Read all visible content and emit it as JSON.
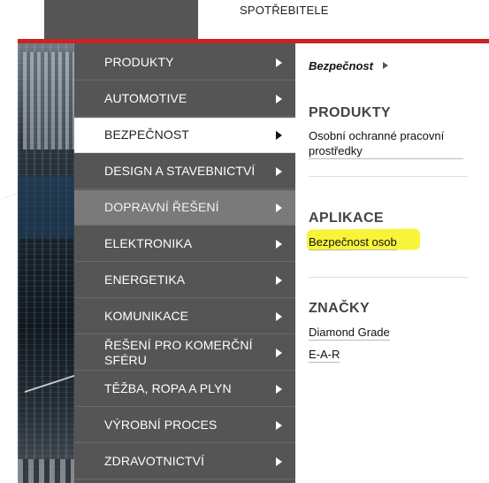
{
  "header": {
    "top_link": "SPOTŘEBITELE",
    "accent_color": "#cc2222"
  },
  "menu": {
    "items": [
      {
        "label": "PRODUKTY",
        "state": "normal"
      },
      {
        "label": "AUTOMOTIVE",
        "state": "normal"
      },
      {
        "label": "BEZPEČNOST",
        "state": "active"
      },
      {
        "label": "DESIGN A STAVEBNICTVÍ",
        "state": "normal"
      },
      {
        "label": "DOPRAVNÍ ŘEŠENÍ",
        "state": "hover"
      },
      {
        "label": "ELEKTRONIKA",
        "state": "normal"
      },
      {
        "label": "ENERGETIKA",
        "state": "normal"
      },
      {
        "label": "KOMUNIKACE",
        "state": "normal"
      },
      {
        "label": "ŘEŠENÍ PRO KOMERČNÍ SFÉRU",
        "state": "normal"
      },
      {
        "label": "TĚŽBA, ROPA A PLYN",
        "state": "normal"
      },
      {
        "label": "VÝROBNÍ PROCES",
        "state": "normal"
      },
      {
        "label": "ZDRAVOTNICTVÍ",
        "state": "normal"
      }
    ],
    "item_arrow_icon": "triangle-right-icon"
  },
  "panel": {
    "breadcrumb": "Bezpečnost",
    "sections": [
      {
        "title": "PRODUKTY",
        "links": [
          "Osobní ochranné pracovní prostředky"
        ]
      },
      {
        "title": "APLIKACE",
        "links": [
          "Bezpečnost osob"
        ],
        "highlight_color": "#f8f43a"
      },
      {
        "title": "ZNAČKY",
        "links": [
          "Diamond Grade",
          "E-A-R"
        ]
      }
    ]
  }
}
